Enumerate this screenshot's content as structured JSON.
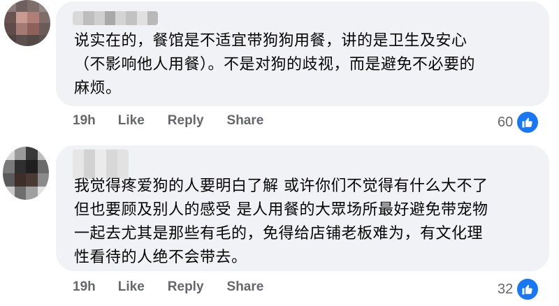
{
  "comments": [
    {
      "text": "说实在的，餐馆是不适宜带狗狗用餐，讲的是卫生及安心\n（不影响他人用餐）。不是对狗的歧视，而是避免不必要的\n麻烦。",
      "time": "19h",
      "like_label": "Like",
      "reply_label": "Reply",
      "share_label": "Share",
      "reaction_count": "60",
      "reaction_icon": "thumbs-up-icon"
    },
    {
      "text": "我觉得疼爱狗的人要明白了解 或许你们不觉得有什么大不了\n但也要顾及别人的感受 是人用餐的大眾场所最好避免带宠物\n一起去尤其是那些有毛的，免得给店铺老板难为，有文化理\n性看待的人绝不会带去。",
      "time": "19h",
      "like_label": "Like",
      "reply_label": "Reply",
      "share_label": "Share",
      "reaction_count": "32",
      "reaction_icon": "thumbs-up-icon"
    }
  ],
  "colors": {
    "bubble": "#f0f2f5",
    "action_text": "#65676b",
    "like_blue": "#1877f2"
  }
}
